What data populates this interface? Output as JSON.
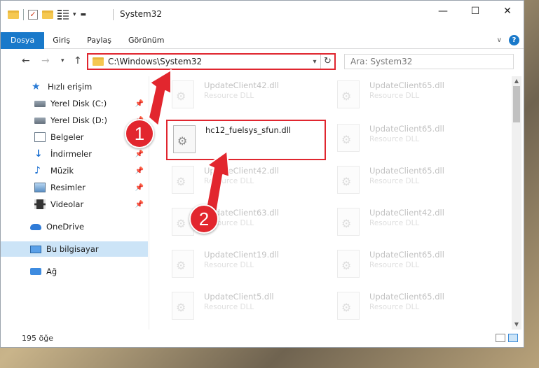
{
  "window": {
    "title": "System32"
  },
  "ribbon": {
    "tabs": [
      "Dosya",
      "Giriş",
      "Paylaş",
      "Görünüm"
    ]
  },
  "address": {
    "path": "C:\\Windows\\System32"
  },
  "search": {
    "placeholder": "Ara: System32"
  },
  "sidebar": {
    "items": [
      {
        "label": "Hızlı erişim",
        "icon": "star-icon"
      },
      {
        "label": "Yerel Disk (C:)",
        "icon": "disk-icon",
        "pinned": true
      },
      {
        "label": "Yerel Disk (D:)",
        "icon": "disk-icon",
        "pinned": true
      },
      {
        "label": "Belgeler",
        "icon": "documents-icon",
        "pinned": true
      },
      {
        "label": "İndirmeler",
        "icon": "download-icon",
        "pinned": true
      },
      {
        "label": "Müzik",
        "icon": "music-icon",
        "pinned": true
      },
      {
        "label": "Resimler",
        "icon": "pictures-icon",
        "pinned": true
      },
      {
        "label": "Videolar",
        "icon": "videos-icon",
        "pinned": true
      },
      {
        "label": "OneDrive",
        "icon": "onedrive-icon"
      },
      {
        "label": "Bu bilgisayar",
        "icon": "this-pc-icon",
        "selected": true
      },
      {
        "label": "Ağ",
        "icon": "network-icon"
      }
    ]
  },
  "files": [
    {
      "name": "UpdateClient42.dll",
      "desc": "Resource DLL"
    },
    {
      "name": "UpdateClient65.dll",
      "desc": "Resource DLL"
    },
    {
      "name": "hc12_fuelsys_sfun.dll",
      "desc": ""
    },
    {
      "name": "UpdateClient65.dll",
      "desc": "Resource DLL"
    },
    {
      "name": "UpdateClient42.dll",
      "desc": "Resource DLL"
    },
    {
      "name": "UpdateClient65.dll",
      "desc": "Resource DLL"
    },
    {
      "name": "UpdateClient63.dll",
      "desc": "Resource DLL"
    },
    {
      "name": "UpdateClient42.dll",
      "desc": "Resource DLL"
    },
    {
      "name": "UpdateClient19.dll",
      "desc": "Resource DLL"
    },
    {
      "name": "UpdateClient65.dll",
      "desc": "Resource DLL"
    },
    {
      "name": "UpdateClient5.dll",
      "desc": "Resource DLL"
    },
    {
      "name": "UpdateClient65.dll",
      "desc": "Resource DLL"
    }
  ],
  "status": {
    "count": "195 öğe"
  },
  "annotations": {
    "step1": "1",
    "step2": "2",
    "color": "#e2262e"
  }
}
